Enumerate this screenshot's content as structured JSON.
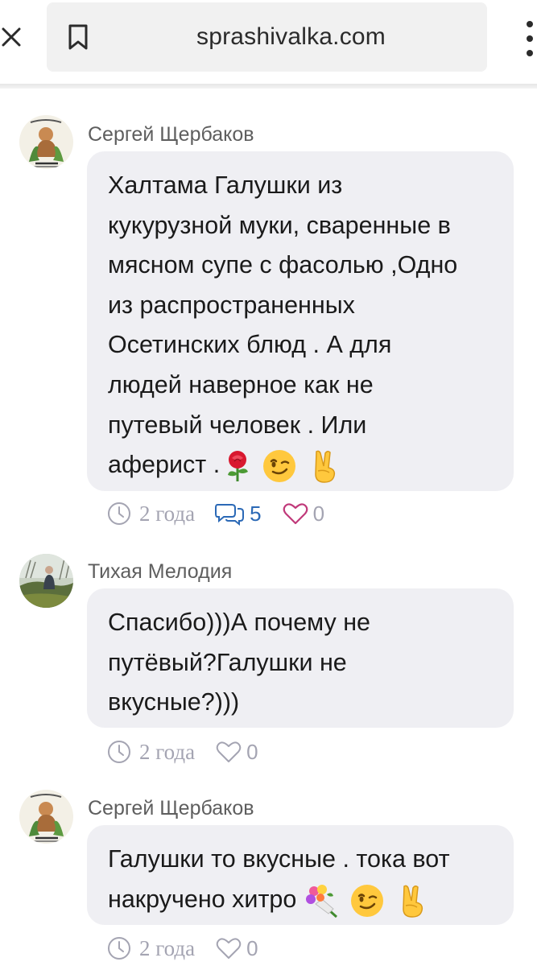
{
  "browser": {
    "url": "sprashivalka.com",
    "close_icon": "close-icon",
    "bookmark_icon": "bookmark-icon",
    "menu_icon": "more-vert-icon"
  },
  "colors": {
    "bubble": "#efeff3",
    "author": "#5e5e5e",
    "meta": "#a4a4b2",
    "replies": "#2b69b6",
    "heart_active": "#c0397a"
  },
  "comments": [
    {
      "author": "Сергей Щербаков",
      "lines": [
        "Халтама Галушки из",
        "кукурузной муки, сваренные в",
        "мясном супе с фасолью ,Одно",
        "из распространенных",
        "Осетинских блюд . А для",
        "людей наверное как не",
        "путевый человек . Или",
        "аферист ."
      ],
      "emojis": [
        "rose-emoji",
        "winking-face-emoji",
        "victory-hand-emoji"
      ],
      "time": "2 года",
      "replies": "5",
      "likes": "0"
    },
    {
      "author": "Тихая Мелодия",
      "lines": [
        "Спасибо)))А почему не",
        "путёвый?Галушки не",
        "вкусные?)))"
      ],
      "emojis": [],
      "time": "2 года",
      "likes": "0"
    },
    {
      "author": "Сергей Щербаков",
      "lines": [
        "Галушки то вкусные . тока вот",
        "накручено хитро"
      ],
      "emojis": [
        "bouquet-emoji",
        "winking-face-emoji",
        "victory-hand-emoji"
      ],
      "time": "2 года",
      "likes": "0"
    }
  ]
}
